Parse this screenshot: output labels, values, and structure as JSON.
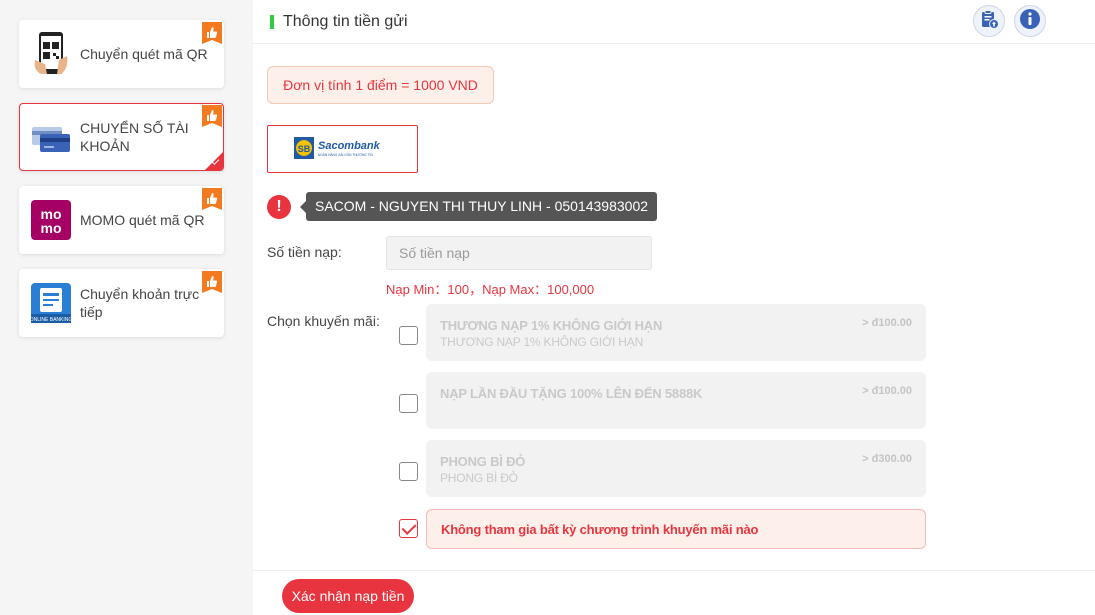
{
  "sidebar": {
    "items": [
      {
        "label": "Chuyển quét mã QR",
        "icon": "phone-qr-icon",
        "active": false
      },
      {
        "label": "CHUYỂN SỐ TÀI KHOẢN",
        "icon": "bank-cards-icon",
        "active": true
      },
      {
        "label": "MOMO quét mã QR",
        "icon": "momo-logo-icon",
        "active": false,
        "logo_text": "mo mo"
      },
      {
        "label": "Chuyển khoản trực tiếp",
        "icon": "online-banking-icon",
        "active": false,
        "logo_text": "ONLINE BANKING"
      }
    ]
  },
  "header": {
    "title": "Thông tin tiền gửi",
    "accent": "#2ecc40"
  },
  "unit_note": "Đơn vị tính 1 điểm = 1000 VND",
  "bank": {
    "name": "Sacombank",
    "tagline": "NGÂN HÀNG SÀI GÒN THƯƠNG TÍN"
  },
  "account_tooltip": "SACOM - NGUYEN THI THUY LINH - 050143983002",
  "amount": {
    "label": "Số tiền nạp:",
    "placeholder": "Số tiền nạp",
    "limits": "Nạp Min：100，Nạp Max：100,000"
  },
  "promo": {
    "label": "Chọn khuyến mãi:",
    "options": [
      {
        "title": "THƯƠNG NẠP 1% KHÔNG GIỚI HẠN",
        "subtitle": "THƯƠNG NẠP 1% KHÔNG GIỚI HẠN",
        "amount": "> đ100.00",
        "checked": false
      },
      {
        "title": "NẠP LẦN ĐẦU TẶNG 100% LÊN ĐẾN 5888K",
        "subtitle": "",
        "amount": "> đ100.00",
        "checked": false
      },
      {
        "title": "PHONG BÌ ĐỎ",
        "subtitle": "PHONG BÌ ĐỎ",
        "amount": "> đ300.00",
        "checked": false
      },
      {
        "title": "Không tham gia bất kỳ chương trình khuyến mãi nào",
        "subtitle": "",
        "amount": "",
        "checked": true
      }
    ]
  },
  "confirm_label": "Xác nhận nạp tiền",
  "colors": {
    "primary": "#e8343e",
    "accent_green": "#2ecc40"
  }
}
